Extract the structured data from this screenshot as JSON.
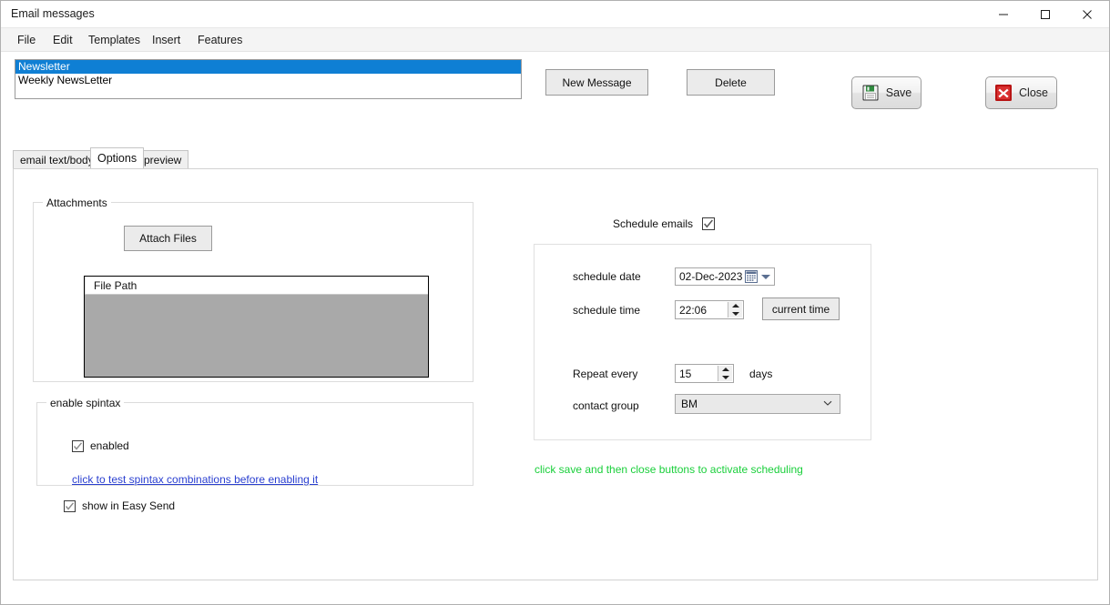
{
  "window": {
    "title": "Email messages",
    "controls": [
      {
        "name": "minimize-button",
        "glyph": "minimize"
      },
      {
        "name": "maximize-button",
        "glyph": "maximize"
      },
      {
        "name": "close-button",
        "glyph": "close"
      }
    ]
  },
  "menubar": {
    "items": [
      {
        "label": "File"
      },
      {
        "label": "Edit"
      },
      {
        "label": "Templates"
      },
      {
        "label": "Insert"
      },
      {
        "label": "Features"
      }
    ]
  },
  "templates_list": {
    "items": [
      {
        "label": "Newsletter",
        "selected": true
      },
      {
        "label": "Weekly NewsLetter",
        "selected": false
      }
    ],
    "selection_color": "#0f7fd4"
  },
  "toolbar": {
    "new_message_label": "New Message",
    "delete_label": "Delete",
    "save_label": "Save",
    "close_label": "Close",
    "save_icon": "floppy-disk-icon",
    "close_icon": "red-x-icon"
  },
  "tabs": [
    {
      "label": "email text/body",
      "active": false
    },
    {
      "label": "Options",
      "active": true
    },
    {
      "label": "preview",
      "active": false
    }
  ],
  "attachments": {
    "legend": "Attachments",
    "attach_button_label": "Attach Files",
    "table": {
      "columns": [
        "File Path"
      ],
      "rows": []
    }
  },
  "spintax": {
    "legend": "enable spintax",
    "enabled_label": "enabled",
    "enabled_checked": true,
    "link_label": "click to test spintax combinations before enabling it",
    "link_color": "#2a3fd0"
  },
  "easy_send": {
    "label": "show in Easy Send",
    "checked": true
  },
  "schedule": {
    "header_label": "Schedule emails",
    "header_checked": true,
    "date_label": "schedule date",
    "date_value": "02-Dec-2023",
    "time_label": "schedule time",
    "time_value": "22:06",
    "current_time_label": "current time",
    "repeat_label": "Repeat every",
    "repeat_value": "15",
    "repeat_unit": "days",
    "contact_group_label": "contact group",
    "contact_group_value": "BM",
    "contact_group_options": [
      "BM"
    ],
    "hint": "click save and then close buttons to activate scheduling",
    "hint_color": "#19cf3a",
    "calendar_icon": "calendar-icon",
    "dropdown_icon": "chevron-down-icon",
    "spinner_icon": "spinner-arrows-icon"
  }
}
